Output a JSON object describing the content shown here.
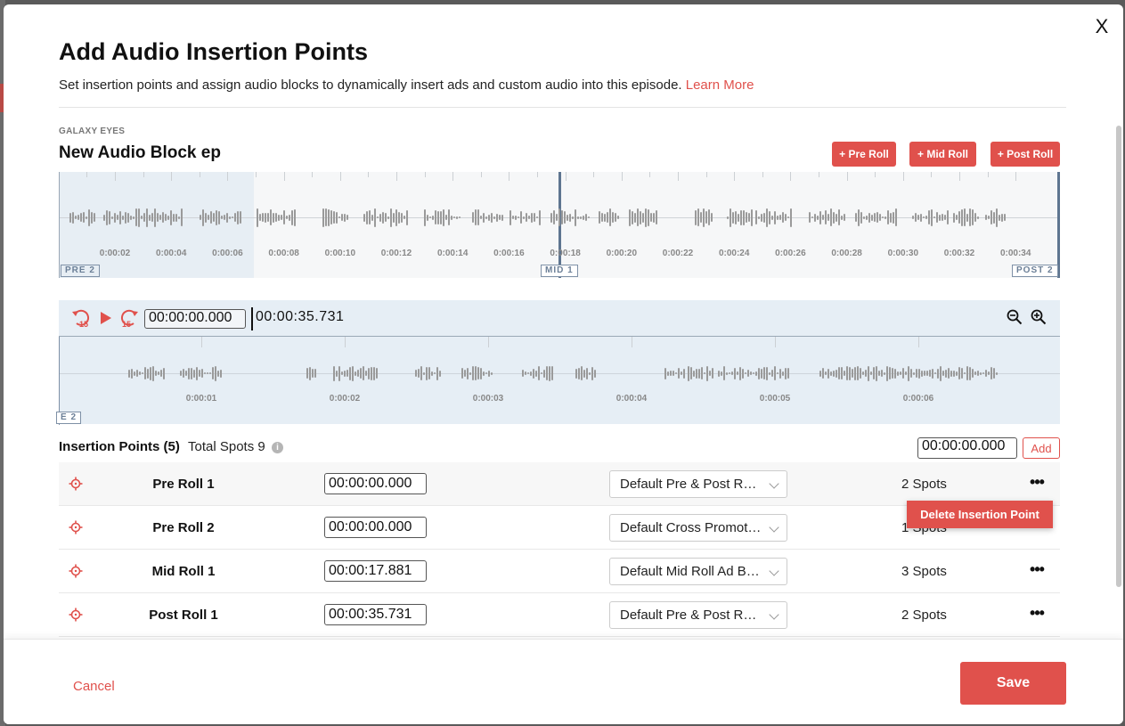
{
  "modal": {
    "close_glyph": "X",
    "title": "Add Audio Insertion Points",
    "subtitle": "Set insertion points and assign audio blocks to dynamically insert ads and custom audio into this episode.",
    "learn_more": "Learn More"
  },
  "episode": {
    "show_name": "GALAXY EYES",
    "title": "New Audio Block ep"
  },
  "roll_buttons": {
    "pre": "+ Pre Roll",
    "mid": "+ Mid Roll",
    "post": "+ Post Roll"
  },
  "overview": {
    "labels": [
      "0:00:02",
      "0:00:04",
      "0:00:06",
      "0:00:08",
      "0:00:10",
      "0:00:12",
      "0:00:14",
      "0:00:16",
      "0:00:18",
      "0:00:20",
      "0:00:22",
      "0:00:24",
      "0:00:26",
      "0:00:28",
      "0:00:30",
      "0:00:32",
      "0:00:34"
    ],
    "markers": {
      "pre": "PRE 2",
      "mid": "MID 1",
      "post": "POST 2"
    }
  },
  "player": {
    "current_time": "00:00:00.000",
    "duration": "00:00:35.731",
    "skip_seconds": "15",
    "detail_labels": [
      "0:00:01",
      "0:00:02",
      "0:00:03",
      "0:00:04",
      "0:00:05",
      "0:00:06"
    ],
    "detail_marker": "E 2",
    "icons": {
      "rewind": "rewind-15-icon",
      "play": "play-icon",
      "forward": "forward-15-icon",
      "zoom_out": "zoom-out-icon",
      "zoom_in": "zoom-in-icon"
    }
  },
  "insertion_points": {
    "header": "Insertion Points (5)",
    "total_spots": "Total Spots 9",
    "info_glyph": "i",
    "new_time": "00:00:00.000",
    "add_label": "Add",
    "rows": [
      {
        "name": "Pre Roll 1",
        "time": "00:00:00.000",
        "block": "Default Pre & Post Roll Ad Block",
        "spots": "2 Spots"
      },
      {
        "name": "Pre Roll 2",
        "time": "00:00:00.000",
        "block": "Default Cross Promotion Block",
        "spots": "1 Spots"
      },
      {
        "name": "Mid Roll 1",
        "time": "00:00:17.881",
        "block": "Default Mid Roll Ad Block",
        "spots": "3 Spots"
      },
      {
        "name": "Post Roll 1",
        "time": "00:00:35.731",
        "block": "Default Pre & Post Roll Ad Block",
        "spots": "2 Spots"
      }
    ],
    "more_glyph": "•••",
    "context_menu": "Delete Insertion Point"
  },
  "footer": {
    "cancel": "Cancel",
    "save": "Save"
  },
  "colors": {
    "accent": "#e0514c",
    "marker": "#5e7590",
    "waveform": "#9a9a9a",
    "player_bg": "#e6eef5"
  }
}
